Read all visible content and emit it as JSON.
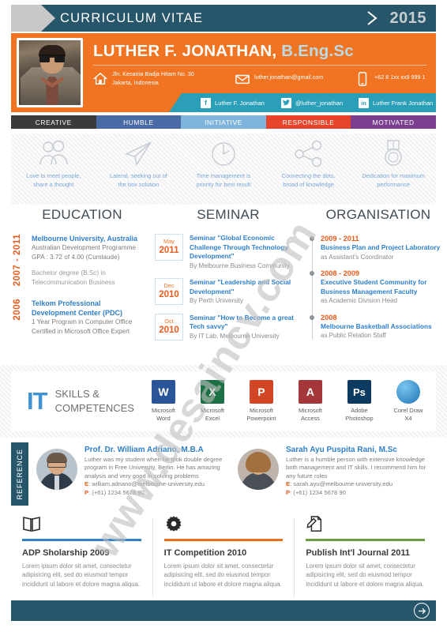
{
  "topbar": {
    "title": "CURRICULUM VITAE",
    "year": "2015",
    "chevron_icon": "chevron-right-icon",
    "bg_color": "#27566b"
  },
  "header": {
    "bg_color": "#f07422",
    "name": "LUTHER F. JONATHAN,",
    "degree": "B.Eng.Sc",
    "photo_alt": "profile-photo",
    "contacts": [
      {
        "icon": "home-icon",
        "text": "Jln. Kesatria Badja Hitam No. 30\nJakarta, Indonesia"
      },
      {
        "icon": "mail-icon",
        "text": "luther.jonathan@gmail.com"
      },
      {
        "icon": "phone-icon",
        "text": "+62 8 1xx xx9 999 1"
      }
    ],
    "social_bar_color": "#2b9fb8",
    "social": [
      {
        "icon": "facebook-icon",
        "glyph": "f",
        "label": "Luther F. Jonathan"
      },
      {
        "icon": "twitter-icon",
        "glyph": "ᵥ",
        "label": "@luther_jonathan"
      },
      {
        "icon": "linkedin-icon",
        "glyph": "in",
        "label": "Luther Frank Jonathan"
      }
    ]
  },
  "traits": [
    {
      "label": "CREATIVE",
      "color": "#3b3b3b"
    },
    {
      "label": "HUMBLE",
      "color": "#4a6aa5"
    },
    {
      "label": "INITIATIVE",
      "color": "#7fb5dd"
    },
    {
      "label": "RESPONSIBLE",
      "color": "#e8442b"
    },
    {
      "label": "MOTIVATED",
      "color": "#7a3f8f"
    }
  ],
  "values": [
    {
      "icon": "people-icon",
      "text": "Love to meet people,\nshare a thought"
    },
    {
      "icon": "paperplane-icon",
      "text": "Lateral, seeking out of\nthe box solution"
    },
    {
      "icon": "clock-icon",
      "text": "Time management is\npriority for best result"
    },
    {
      "icon": "share-nodes-icon",
      "text": "Connecting the dots,\nbroad of knowledge"
    },
    {
      "icon": "medal-icon",
      "text": "Dedication for maximum\nperformance"
    }
  ],
  "education": {
    "heading": "EDUCATION",
    "items": [
      {
        "years": "2007 - 2011",
        "title": "Melbourne University, Australia",
        "sub": "Australian Development Programme\nGPA : 3.72 of 4.00 (Cumlaude)",
        "sub2": "Bachelor degree (B.Sc) in\nTelecommunication Business"
      },
      {
        "years": "2006",
        "title": "Telkom Professional\nDevelopment Center  (PDC)",
        "sub": "1 Year Program in Computer Office\nCertified in Microsoft Office Expert",
        "sub2": ""
      }
    ]
  },
  "seminar": {
    "heading": "SEMINAR",
    "items": [
      {
        "month": "May",
        "year": "2011",
        "title": "Seminar \"Global Economic Challenge Through Technology Development\"",
        "by": "By Melbourne Business Community"
      },
      {
        "month": "Dec",
        "year": "2010",
        "title": "Seminar \"Leadership and Social Development\"",
        "by": "By Perth University"
      },
      {
        "month": "Oct",
        "year": "2010",
        "title": "Seminar \"How to Become a great Tech savvy\"",
        "by": "By IT Lab, Melbourne University"
      }
    ]
  },
  "organisation": {
    "heading": "ORGANISATION",
    "items": [
      {
        "year": "2009 - 2011",
        "title": "Business Plan and Project Laboratory",
        "role": "as Assistant's Coordinator"
      },
      {
        "year": "2008 - 2009",
        "title": "Executive Student Community for\nBusiness Management Faculty",
        "role": "as Academic Division Head"
      },
      {
        "year": "2008",
        "title": "Melbourne Basketball Associations",
        "role": "as Public Relation Staff"
      }
    ]
  },
  "it_skills": {
    "logo": "IT",
    "logo_color": "#3f93d4",
    "label": "SKILLS &\nCOMPETENCES",
    "apps": [
      {
        "icon": "ms-word-icon",
        "glyph": "W",
        "color": "#2a5699",
        "label": "Microsoft\nWord"
      },
      {
        "icon": "ms-excel-icon",
        "glyph": "X",
        "color": "#1d7044",
        "label": "Microsoft\nExcel"
      },
      {
        "icon": "ms-powerpoint-icon",
        "glyph": "P",
        "color": "#d24625",
        "label": "Microsoft\nPowerpoint"
      },
      {
        "icon": "ms-access-icon",
        "glyph": "A",
        "color": "#a4373a",
        "label": "Microsoft\nAccess"
      },
      {
        "icon": "adobe-photoshop-icon",
        "glyph": "Ps",
        "color": "#0d3a60",
        "label": "Adobe\nPhotoshop"
      },
      {
        "icon": "corel-draw-icon",
        "glyph": "●",
        "color": "#2e8fd1",
        "label": "Corel Draw\nX4"
      }
    ]
  },
  "reference": {
    "tab_label": "REFERENCE",
    "tab_color": "#27566b",
    "items": [
      {
        "avatar": "avatar-male",
        "name": "Prof. Dr. William Adriano, M.B.A",
        "desc": "Luther was my student when he took double degree program in Free University, Berlin. He has amazing analysis and very good in solving problems",
        "email_label": "E",
        "email": ": william.adriano@melbourne-university.edu",
        "phone_label": "P",
        "phone": ": (+61) 1234 5678 90"
      },
      {
        "avatar": "avatar-female",
        "name": "Sarah Ayu Puspita Rani, M.Sc",
        "desc": "Luther is a humble person with extensive knowledge both management and IT skills. I recommend him for any future roles",
        "email_label": "E",
        "email": ": sarah.ayu@melbourne-university.edu",
        "phone_label": "P",
        "phone": ": (+61) 1234 5678 90"
      }
    ]
  },
  "achievements": [
    {
      "icon": "open-book-icon",
      "rule_color": "#2f7fc9",
      "title": "ADP Sholarship 2009",
      "text": "Lorem ipsum dolor sit amet, consectetur adipisicing elit, sed do eiusmod tempor incididunt ut labore et dolore magna aliqua."
    },
    {
      "icon": "gear-icon",
      "rule_color": "#e8701a",
      "title": "IT Competition 2010",
      "text": "Lorem ipsum dolor sit amet, consectetur adipisicing elit, sed do eiusmod tempor incididunt ut labore et dolore magna aliqua."
    },
    {
      "icon": "document-pen-icon",
      "rule_color": "#6b9c3f",
      "title": "Publish Int'l Journal 2011",
      "text": "Lorem ipsum dolor sit amet, consectetur adipisicing elit, sed do eiusmod tempor incididunt ut labore et dolore magna aliqua."
    }
  ],
  "footer": {
    "bg_color": "#27566b",
    "arrow_icon": "arrow-right-circle-icon"
  },
  "watermark": {
    "text": "www.desaincv.com"
  }
}
